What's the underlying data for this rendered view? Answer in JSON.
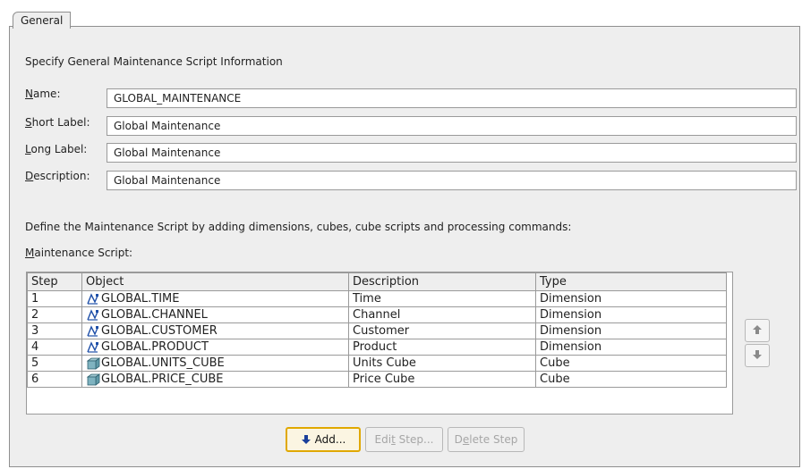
{
  "tab": {
    "label": "General"
  },
  "heading": "Specify General Maintenance Script Information",
  "fields": [
    {
      "label": "Name:",
      "value": "GLOBAL_MAINTENANCE"
    },
    {
      "label": "Short Label:",
      "value": "Global Maintenance"
    },
    {
      "label": "Long Label:",
      "value": "Global Maintenance"
    },
    {
      "label": "Description:",
      "value": "Global Maintenance"
    }
  ],
  "instructions": "Define the Maintenance Script by adding dimensions, cubes, cube scripts and processing commands:",
  "script_label": "Maintenance Script:",
  "table": {
    "columns": [
      "Step",
      "Object",
      "Description",
      "Type"
    ],
    "rows": [
      {
        "step": "1",
        "object": "GLOBAL.TIME",
        "icon": "dimension-icon",
        "description": "Time",
        "type": "Dimension"
      },
      {
        "step": "2",
        "object": "GLOBAL.CHANNEL",
        "icon": "dimension-icon",
        "description": "Channel",
        "type": "Dimension"
      },
      {
        "step": "3",
        "object": "GLOBAL.CUSTOMER",
        "icon": "dimension-icon",
        "description": "Customer",
        "type": "Dimension"
      },
      {
        "step": "4",
        "object": "GLOBAL.PRODUCT",
        "icon": "dimension-icon",
        "description": "Product",
        "type": "Dimension"
      },
      {
        "step": "5",
        "object": "GLOBAL.UNITS_CUBE",
        "icon": "cube-icon",
        "description": "Units Cube",
        "type": "Cube"
      },
      {
        "step": "6",
        "object": "GLOBAL.PRICE_CUBE",
        "icon": "cube-icon",
        "description": "Price Cube",
        "type": "Cube"
      }
    ]
  },
  "buttons": {
    "add": "Add...",
    "edit_step": "Edit Step...",
    "delete_step": "Delete Step"
  },
  "colors": {
    "focus_border": "#e0a800",
    "arrow_blue": "#1a3f9a"
  }
}
